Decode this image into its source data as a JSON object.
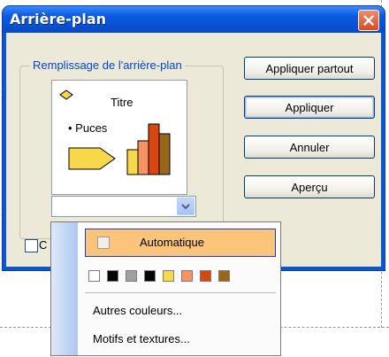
{
  "dialog": {
    "title": "Arrière-plan",
    "group_label": "Remplissage de l'arrière-plan",
    "preview": {
      "title_text": "Titre",
      "bullet_text": "• Puces"
    },
    "buttons": {
      "apply_all": "Appliquer partout",
      "apply": "Appliquer",
      "cancel": "Annuler",
      "preview": "Aperçu"
    },
    "checkbox_fragment": "C"
  },
  "dropdown": {
    "automatic_label": "Automatique",
    "swatch_colors": [
      "#ffffff",
      "#000000",
      "#a0a0a0",
      "#000000",
      "#f7d84a",
      "#f79262",
      "#d84712",
      "#98671a"
    ],
    "more_colors": "Autres couleurs...",
    "patterns": "Motifs et textures..."
  },
  "colors": {
    "title_bar": "#0a55d8",
    "group_label": "#0046d5",
    "dialog_face": "#ece9d8",
    "highlight": "#fbc47a"
  },
  "icons": [
    "close-icon",
    "chevron-down-icon",
    "diamond-bullet-icon",
    "arrow-shape-icon",
    "bar-chart-icon"
  ]
}
